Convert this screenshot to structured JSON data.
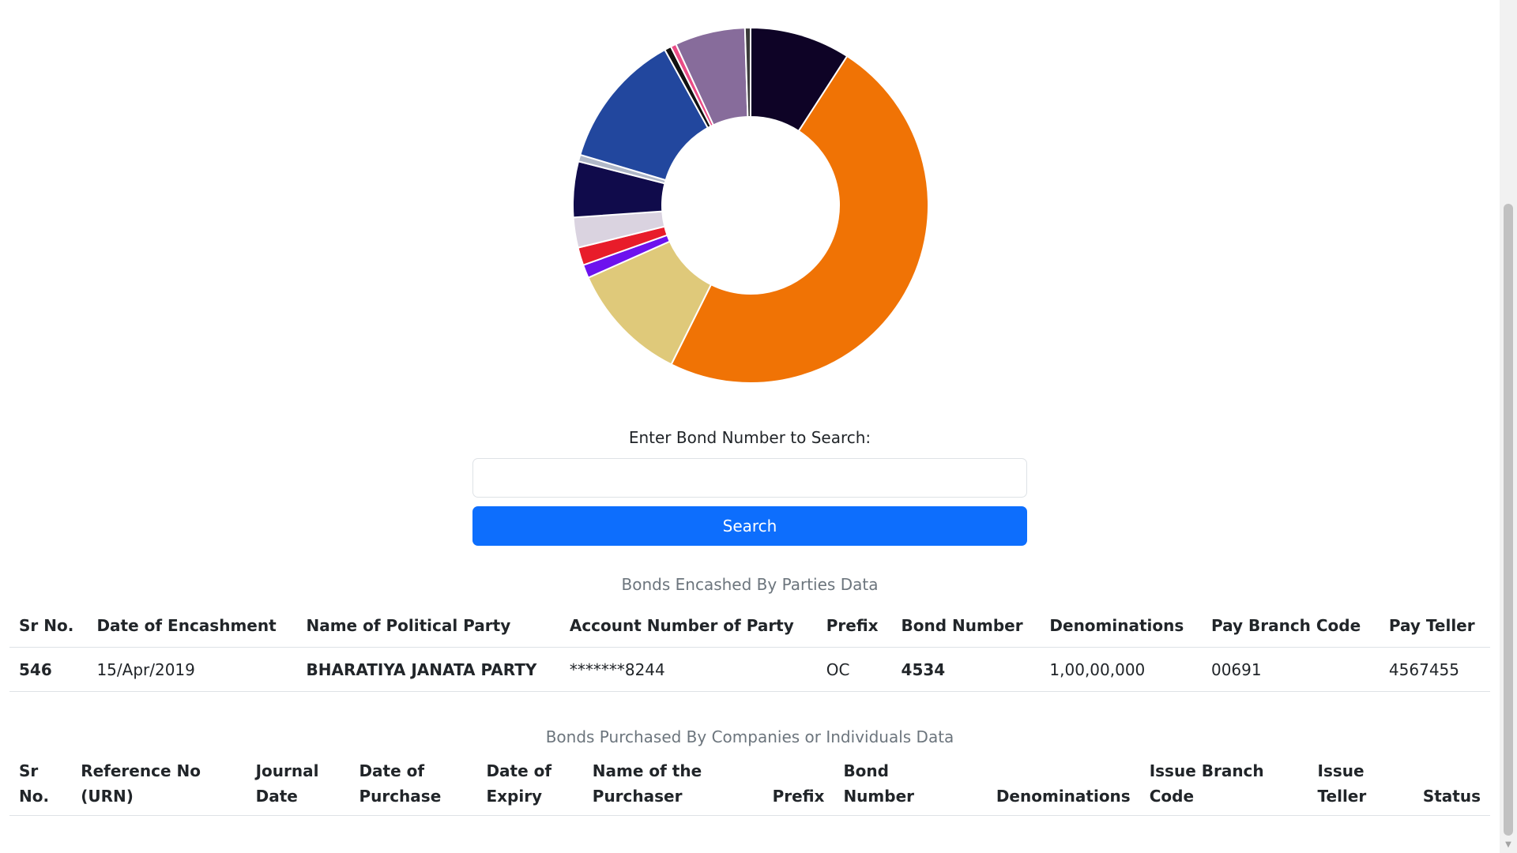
{
  "chart_data": {
    "type": "pie",
    "title": "",
    "segments": [
      {
        "value": 9.0,
        "color": "#0e0326"
      },
      {
        "value": 47.5,
        "color": "#f07305"
      },
      {
        "value": 10.8,
        "color": "#dfc97a"
      },
      {
        "value": 1.2,
        "color": "#6d12ee"
      },
      {
        "value": 1.6,
        "color": "#e81c2a"
      },
      {
        "value": 2.7,
        "color": "#dad3e0"
      },
      {
        "value": 5.0,
        "color": "#100b4b"
      },
      {
        "value": 0.6,
        "color": "#b0b8c8"
      },
      {
        "value": 12.2,
        "color": "#22479e"
      },
      {
        "value": 0.6,
        "color": "#111111"
      },
      {
        "value": 0.5,
        "color": "#ea4c86"
      },
      {
        "value": 6.3,
        "color": "#876c9b"
      },
      {
        "value": 0.5,
        "color": "#3a3a3a"
      }
    ]
  },
  "search": {
    "label": "Enter Bond Number to Search:",
    "placeholder": "",
    "button_label": "Search"
  },
  "encashed": {
    "caption": "Bonds Encashed By Parties Data",
    "headers": [
      "Sr No.",
      "Date of Encashment",
      "Name of Political Party",
      "Account Number of Party",
      "Prefix",
      "Bond Number",
      "Denominations",
      "Pay Branch Code",
      "Pay Teller"
    ],
    "rows": [
      [
        "546",
        "15/Apr/2019",
        "BHARATIYA JANATA PARTY",
        "*******8244",
        "OC",
        "4534",
        "1,00,00,000",
        "00691",
        "4567455"
      ]
    ]
  },
  "purchased": {
    "caption": "Bonds Purchased By Companies or Individuals Data",
    "headers": [
      [
        "Sr",
        "No."
      ],
      [
        "Reference No",
        "(URN)"
      ],
      [
        "Journal",
        "Date"
      ],
      [
        "Date of",
        "Purchase"
      ],
      [
        "Date of",
        "Expiry"
      ],
      [
        "Name of the",
        "Purchaser"
      ],
      [
        "",
        "Prefix"
      ],
      [
        "Bond",
        "Number"
      ],
      [
        "",
        "Denominations"
      ],
      [
        "Issue Branch",
        "Code"
      ],
      [
        "Issue",
        "Teller"
      ],
      [
        "",
        "Status"
      ]
    ]
  },
  "scrollbar": {
    "down_arrow_icon": "chevron-down-icon"
  }
}
